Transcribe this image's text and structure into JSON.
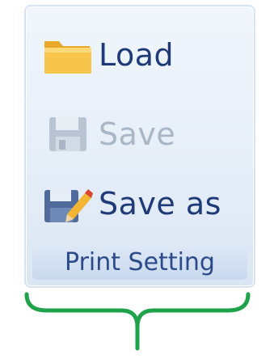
{
  "ribbon_group": {
    "title": "Print Setting",
    "buttons": [
      {
        "label": "Load",
        "icon": "folder-icon",
        "enabled": true
      },
      {
        "label": "Save",
        "icon": "save-icon",
        "enabled": false
      },
      {
        "label": "Save as",
        "icon": "save-as-icon",
        "enabled": true
      }
    ]
  },
  "colors": {
    "label_text": "#1f3a78",
    "disabled_text": "#a9b6c6",
    "group_border": "#d7e3f1",
    "brace": "#1ea34a",
    "folder": "#f7c54a"
  }
}
